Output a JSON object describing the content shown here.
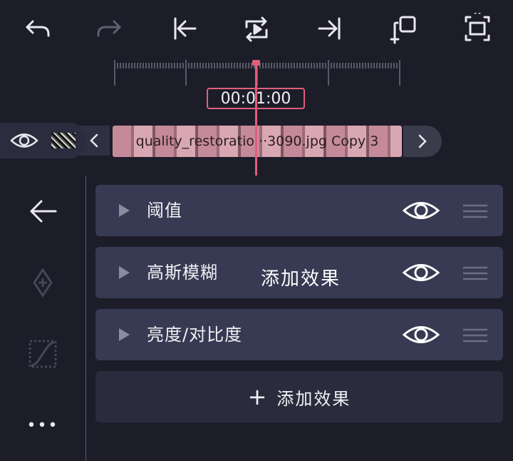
{
  "toolbar": {
    "buttons": [
      "undo-icon",
      "redo-icon",
      "jump-to-start-icon",
      "loop-play-icon",
      "jump-to-end-icon",
      "duplicate-icon",
      "fullscreen-icon"
    ]
  },
  "timeline": {
    "timecode": "00:01:00",
    "clip_label": "quality_restoratio···3090.jpg Copy 3",
    "accent": "#e35d7a"
  },
  "sidebar": {
    "icons": [
      "back-arrow-icon",
      "keyframe-diamond-icon",
      "curve-icon",
      "more-icon"
    ],
    "more_label": "•••"
  },
  "effects": {
    "items": [
      {
        "label": "阈值"
      },
      {
        "label": "高斯模糊"
      },
      {
        "label": "亮度/对比度"
      }
    ],
    "overlay_label": "添加效果",
    "add_button": {
      "plus": "+",
      "label": "添加效果"
    }
  }
}
